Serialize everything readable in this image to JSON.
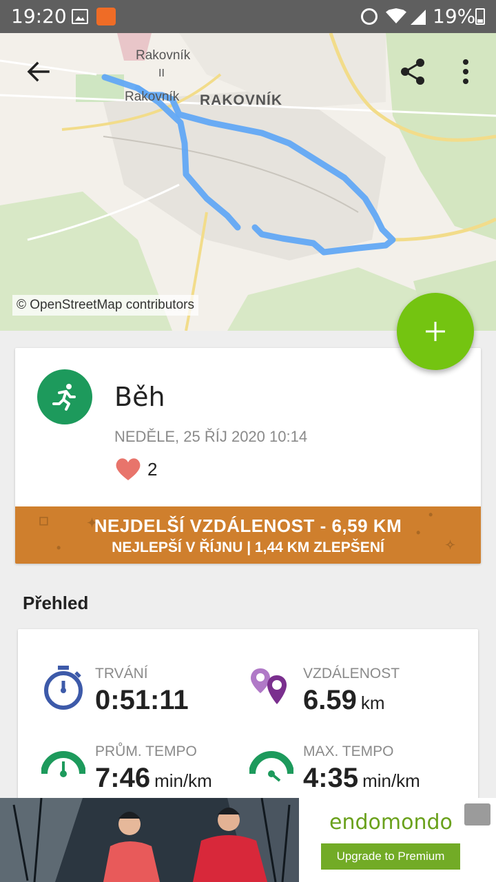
{
  "status_bar": {
    "time": "19:20",
    "battery": "19%",
    "icons": [
      "image-icon",
      "app-notification-icon",
      "alarm-icon",
      "wifi-icon",
      "signal-icon",
      "battery-icon"
    ]
  },
  "map": {
    "labels": {
      "small_town": "Rakovník",
      "road_number": "II",
      "small_town_2": "Rakovník",
      "city": "RAKOVNÍK"
    },
    "attribution": "© OpenStreetMap contributors",
    "route_color": "#62a8f4"
  },
  "toolbar": {
    "back_icon": "arrow-left-icon",
    "share_icon": "share-icon",
    "more_icon": "more-vert-icon"
  },
  "fab": {
    "icon": "plus-icon",
    "color": "#74c411"
  },
  "activity": {
    "sport": "Běh",
    "sport_icon": "running-person-icon",
    "date": "NEDĚLE, 25 ŘÍJ 2020 10:14",
    "likes": "2",
    "accent": "#1d9a5c"
  },
  "banner": {
    "line1": "NEJDELŠÍ VZDÁLENOST  -  6,59 KM",
    "line2": "NEJLEPŠÍ V ŘÍJNU  |  1,44 KM ZLEPŠENÍ",
    "color": "#cf7f2d"
  },
  "overview": {
    "title": "Přehled",
    "stats": [
      {
        "label": "TRVÁNÍ",
        "value": "0:51:11",
        "unit": "",
        "icon": "stopwatch-icon"
      },
      {
        "label": "VZDÁLENOST",
        "value": "6.59",
        "unit": "km",
        "icon": "location-pins-icon"
      },
      {
        "label": "PRŮM. TEMPO",
        "value": "7:46",
        "unit": "min/km",
        "icon": "speedometer-icon"
      },
      {
        "label": "MAX. TEMPO",
        "value": "4:35",
        "unit": "min/km",
        "icon": "speedometer-max-icon"
      }
    ]
  },
  "ad": {
    "brand": "endomondo",
    "cta": "Upgrade to Premium"
  }
}
